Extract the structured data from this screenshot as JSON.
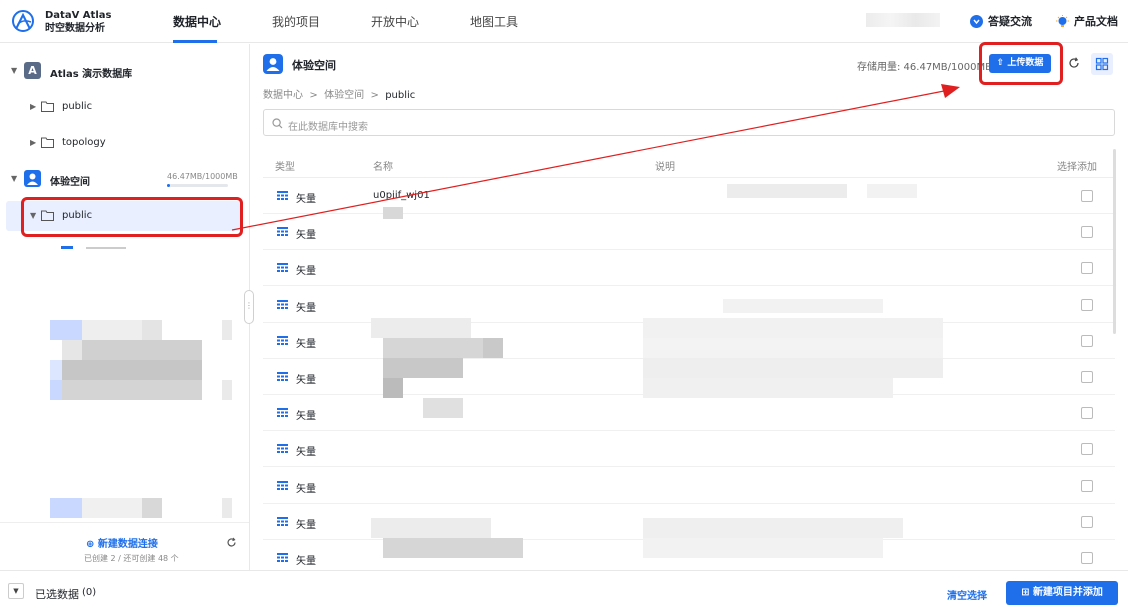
{
  "brand": {
    "line1": "DataV Atlas",
    "line2": "时空数据分析"
  },
  "nav": {
    "tabs": [
      "数据中心",
      "我的项目",
      "开放中心",
      "地图工具"
    ],
    "active_index": 0
  },
  "header_links": {
    "qa": "答疑交流",
    "docs": "产品文档"
  },
  "sidebar": {
    "atlas_db": {
      "badge": "A",
      "label": "Atlas 演示数据库"
    },
    "atlas_children": [
      "public",
      "topology"
    ],
    "space_db": {
      "label": "体验空间",
      "storage": "46.47MB/1000MB",
      "used_fraction": 0.046
    },
    "space_children": [
      "public"
    ],
    "new_connection": "新建数据连接",
    "connection_info": "已创建 2 / 还可创建 48 个"
  },
  "main": {
    "space_title": "体验空间",
    "storage_used": "存储用量: 46.47MB/1000MB",
    "upload_label": "上传数据",
    "breadcrumb": [
      "数据中心",
      "体验空间",
      "public"
    ],
    "search_placeholder": "在此数据库中搜索",
    "columns": {
      "type": "类型",
      "name": "名称",
      "desc": "说明",
      "select": "选择添加"
    },
    "rows": [
      {
        "type": "矢量",
        "name": "u0piif_wj01"
      },
      {
        "type": "矢量",
        "name": ""
      },
      {
        "type": "矢量",
        "name": ""
      },
      {
        "type": "矢量",
        "name": ""
      },
      {
        "type": "矢量",
        "name": ""
      },
      {
        "type": "矢量",
        "name": ""
      },
      {
        "type": "矢量",
        "name": ""
      },
      {
        "type": "矢量",
        "name": ""
      },
      {
        "type": "矢量",
        "name": ""
      },
      {
        "type": "矢量",
        "name": ""
      },
      {
        "type": "矢量",
        "name": ""
      }
    ]
  },
  "bottom_bar": {
    "selected_label": "已选数据",
    "selected_count": "(0)",
    "clear_label": "清空选择",
    "create_label": "新建项目并添加"
  },
  "colors": {
    "accent": "#1f6feb",
    "highlight": "#e02020"
  }
}
